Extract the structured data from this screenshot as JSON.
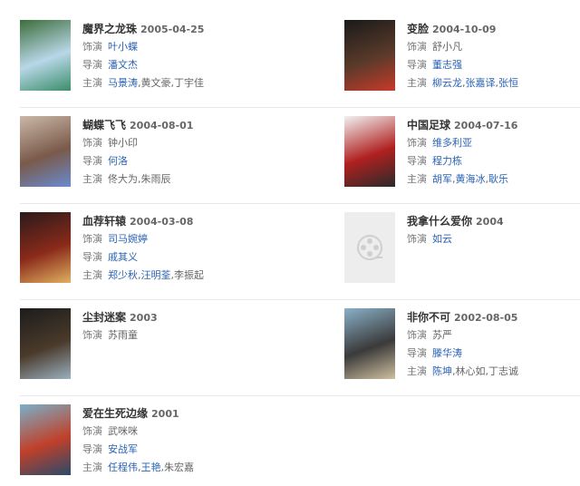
{
  "roles": {
    "actor": "饰演",
    "director": "导演",
    "starring": "主演"
  },
  "movies": [
    {
      "title": "魔界之龙珠",
      "date": "2005-04-25",
      "actor": [
        {
          "name": "叶小蝶",
          "link": true
        }
      ],
      "director": [
        {
          "name": "潘文杰",
          "link": true
        }
      ],
      "starring": [
        {
          "name": "马景涛",
          "link": true
        },
        {
          "name": "黄文豪",
          "link": false
        },
        {
          "name": "丁宇佳",
          "link": false
        }
      ],
      "poster": "poster-image",
      "colors": [
        "#3b6e3a",
        "#b9d7e8",
        "#3b8d6a"
      ]
    },
    {
      "title": "变脸",
      "date": "2004-10-09",
      "actor": [
        {
          "name": "舒小凡",
          "link": false
        }
      ],
      "director": [
        {
          "name": "董志强",
          "link": true
        }
      ],
      "starring": [
        {
          "name": "柳云龙",
          "link": true
        },
        {
          "name": "张嘉译",
          "link": true
        },
        {
          "name": "张恒",
          "link": true
        }
      ],
      "poster": "poster-image",
      "colors": [
        "#1a1a1a",
        "#5a3a2a",
        "#c83a2a"
      ]
    },
    {
      "title": "蝴蝶飞飞",
      "date": "2004-08-01",
      "actor": [
        {
          "name": "钟小印",
          "link": false
        }
      ],
      "director": [
        {
          "name": "何洛",
          "link": true
        }
      ],
      "starring": [
        {
          "name": "佟大为",
          "link": false
        },
        {
          "name": "朱雨辰",
          "link": false
        }
      ],
      "poster": "poster-image",
      "colors": [
        "#cbb8a8",
        "#7a5a4a",
        "#6a8ad0"
      ]
    },
    {
      "title": "中国足球",
      "date": "2004-07-16",
      "actor": [
        {
          "name": "维多利亚",
          "link": true
        }
      ],
      "director": [
        {
          "name": "程力栋",
          "link": true
        }
      ],
      "starring": [
        {
          "name": "胡军",
          "link": true
        },
        {
          "name": "黄海冰",
          "link": true
        },
        {
          "name": "耿乐",
          "link": true
        }
      ],
      "poster": "poster-image",
      "colors": [
        "#f2f2f2",
        "#b02020",
        "#2a2a2a"
      ]
    },
    {
      "title": "血荐轩辕",
      "date": "2004-03-08",
      "actor": [
        {
          "name": "司马婉婷",
          "link": true
        }
      ],
      "director": [
        {
          "name": "戚其义",
          "link": true
        }
      ],
      "starring": [
        {
          "name": "郑少秋",
          "link": true
        },
        {
          "name": "汪明荃",
          "link": true
        },
        {
          "name": "李振起",
          "link": false
        }
      ],
      "poster": "poster-image",
      "colors": [
        "#2a1a1a",
        "#8a2a1a",
        "#e0b060"
      ]
    },
    {
      "title": "我拿什么爱你",
      "date": "2004",
      "actor": [
        {
          "name": "如云",
          "link": true
        }
      ],
      "director": [],
      "starring": [],
      "poster": "placeholder",
      "colors": [
        "#ededed",
        "#dcdcdc",
        "#ededed"
      ]
    },
    {
      "title": "尘封迷案",
      "date": "2003",
      "actor": [
        {
          "name": "苏雨童",
          "link": false
        }
      ],
      "director": [],
      "starring": [],
      "poster": "poster-image",
      "colors": [
        "#1c1c1c",
        "#4a3a2a",
        "#9ab0c0"
      ]
    },
    {
      "title": "非你不可",
      "date": "2002-08-05",
      "actor": [
        {
          "name": "苏严",
          "link": false
        }
      ],
      "director": [
        {
          "name": "滕华涛",
          "link": true
        }
      ],
      "starring": [
        {
          "name": "陈坤",
          "link": true
        },
        {
          "name": "林心如",
          "link": false
        },
        {
          "name": "丁志诚",
          "link": false
        }
      ],
      "poster": "poster-image",
      "colors": [
        "#8ab0c8",
        "#3a3a3a",
        "#d0c0a0"
      ]
    },
    {
      "title": "爱在生死边缘",
      "date": "2001",
      "actor": [
        {
          "name": "武咪咪",
          "link": false
        }
      ],
      "director": [
        {
          "name": "安战军",
          "link": true
        }
      ],
      "starring": [
        {
          "name": "任程伟",
          "link": true
        },
        {
          "name": "王艳",
          "link": true
        },
        {
          "name": "朱宏嘉",
          "link": false
        }
      ],
      "poster": "poster-image",
      "colors": [
        "#7ab0c8",
        "#c0402a",
        "#2a4a6a"
      ]
    }
  ]
}
